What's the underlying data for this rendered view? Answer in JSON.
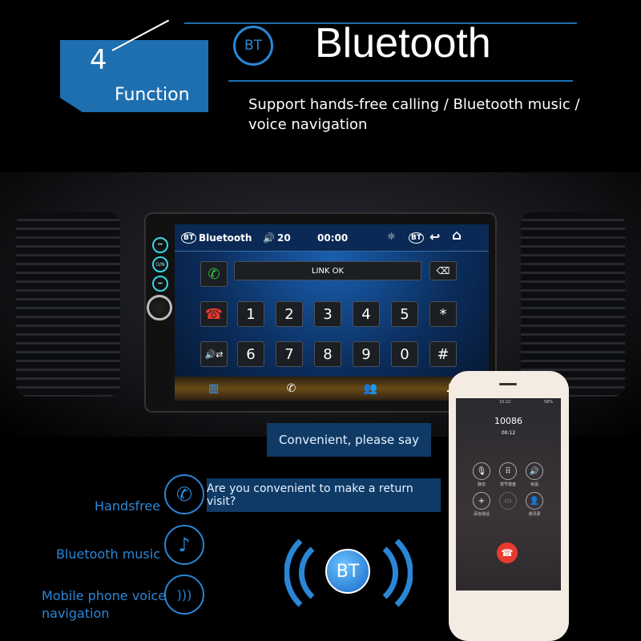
{
  "header": {
    "badge_number": "4",
    "badge_label": "Function",
    "bt_icon": "BT",
    "title": "Bluetooth",
    "subtitle_line1": "Support hands-free calling / Bluetooth music /",
    "subtitle_line2": "voice navigation"
  },
  "head_unit": {
    "status": {
      "bt": "BT",
      "label": "Bluetooth",
      "volume": "20",
      "time": "00:00"
    },
    "link_status": "LINK OK",
    "keys_row1": [
      "1",
      "2",
      "3",
      "4",
      "5",
      "*"
    ],
    "keys_row2": [
      "6",
      "7",
      "8",
      "9",
      "0",
      "#"
    ],
    "side_buttons": [
      "⏮",
      "O/N",
      "⏭"
    ]
  },
  "bubbles": {
    "reply": "Convenient, please say",
    "question": "Are you convenient to make a return visit?"
  },
  "features": [
    {
      "label": "Handsfree",
      "icon": "phone-icon"
    },
    {
      "label": "Bluetooth music",
      "icon": "music-note-icon"
    },
    {
      "label_line1": "Mobile phone voice",
      "label_line2": "navigation",
      "icon": "voice-waves-icon"
    }
  ],
  "bt_logo": "BT",
  "phone": {
    "number": "10086",
    "duration": "00:12",
    "time": "10:22",
    "battery": "58%",
    "buttons": [
      "静音",
      "拨号键盘",
      "免提",
      "添加通话",
      "",
      "通讯录"
    ]
  },
  "colors": {
    "accent": "#2a86d6",
    "badge": "#1e6fb0",
    "hangup": "#e8392f",
    "answer": "#2ecc40"
  }
}
